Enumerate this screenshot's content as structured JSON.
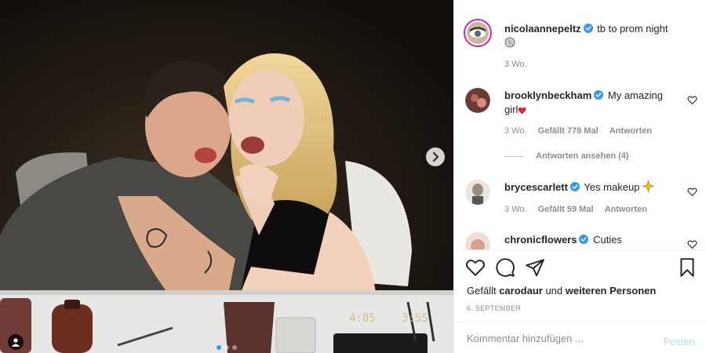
{
  "colors": {
    "accent": "#3897f0",
    "verified": "#3897f0",
    "muted": "#8e8e8e",
    "text": "#262626",
    "post_button_disabled": "#b2dffc"
  },
  "media": {
    "photo_print": {
      "left": "4:05",
      "right": "3:55"
    },
    "carousel": {
      "total": 3,
      "active": 1
    },
    "icons": {
      "next": "chevron-right-icon",
      "tags": "user-tag-icon"
    }
  },
  "caption": {
    "username": "nicolaannepeltz",
    "text": " tb to prom night",
    "emoji": "disco-ball-emoji",
    "time": "3 Wo."
  },
  "comments": [
    {
      "username": "brooklynbeckham",
      "text": " My amazing girl",
      "emoji": "red-heart-emoji",
      "time": "3 Wo.",
      "likes": "Gefällt 778 Mal",
      "reply": "Antworten",
      "view_replies": "Antworten ansehen (4)"
    },
    {
      "username": "brycescarlett",
      "text": " Yes makeup ",
      "emoji": "sparkle-emoji",
      "time": "3 Wo.",
      "likes": "Gefällt 59 Mal",
      "reply": "Antworten"
    },
    {
      "username": "chronicflowers",
      "text": " Cuties"
    }
  ],
  "actions": {
    "like": "heart-icon",
    "comment": "comment-icon",
    "share": "share-icon",
    "save": "bookmark-icon"
  },
  "liked_by": {
    "prefix": "Gefällt ",
    "user": "carodaur",
    "middle": " und ",
    "others": "weiteren Personen"
  },
  "date": "6. SEPTEMBER",
  "comment_box": {
    "placeholder": "Kommentar hinzufügen ...",
    "post_label": "Posten"
  }
}
